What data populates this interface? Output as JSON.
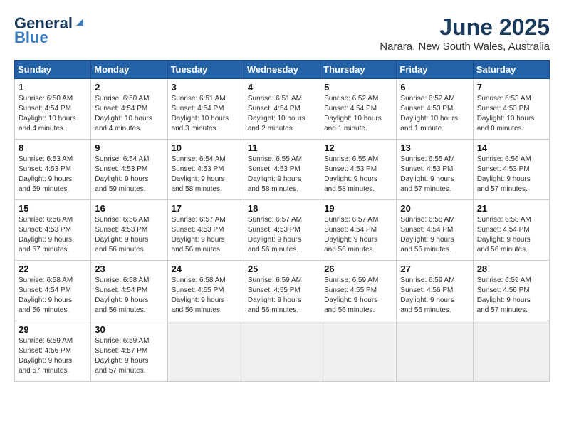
{
  "logo": {
    "line1": "General",
    "line2": "Blue"
  },
  "title": "June 2025",
  "location": "Narara, New South Wales, Australia",
  "headers": [
    "Sunday",
    "Monday",
    "Tuesday",
    "Wednesday",
    "Thursday",
    "Friday",
    "Saturday"
  ],
  "weeks": [
    [
      {
        "day": "1",
        "text": "Sunrise: 6:50 AM\nSunset: 4:54 PM\nDaylight: 10 hours\nand 4 minutes."
      },
      {
        "day": "2",
        "text": "Sunrise: 6:50 AM\nSunset: 4:54 PM\nDaylight: 10 hours\nand 4 minutes."
      },
      {
        "day": "3",
        "text": "Sunrise: 6:51 AM\nSunset: 4:54 PM\nDaylight: 10 hours\nand 3 minutes."
      },
      {
        "day": "4",
        "text": "Sunrise: 6:51 AM\nSunset: 4:54 PM\nDaylight: 10 hours\nand 2 minutes."
      },
      {
        "day": "5",
        "text": "Sunrise: 6:52 AM\nSunset: 4:54 PM\nDaylight: 10 hours\nand 1 minute."
      },
      {
        "day": "6",
        "text": "Sunrise: 6:52 AM\nSunset: 4:53 PM\nDaylight: 10 hours\nand 1 minute."
      },
      {
        "day": "7",
        "text": "Sunrise: 6:53 AM\nSunset: 4:53 PM\nDaylight: 10 hours\nand 0 minutes."
      }
    ],
    [
      {
        "day": "8",
        "text": "Sunrise: 6:53 AM\nSunset: 4:53 PM\nDaylight: 9 hours\nand 59 minutes."
      },
      {
        "day": "9",
        "text": "Sunrise: 6:54 AM\nSunset: 4:53 PM\nDaylight: 9 hours\nand 59 minutes."
      },
      {
        "day": "10",
        "text": "Sunrise: 6:54 AM\nSunset: 4:53 PM\nDaylight: 9 hours\nand 58 minutes."
      },
      {
        "day": "11",
        "text": "Sunrise: 6:55 AM\nSunset: 4:53 PM\nDaylight: 9 hours\nand 58 minutes."
      },
      {
        "day": "12",
        "text": "Sunrise: 6:55 AM\nSunset: 4:53 PM\nDaylight: 9 hours\nand 58 minutes."
      },
      {
        "day": "13",
        "text": "Sunrise: 6:55 AM\nSunset: 4:53 PM\nDaylight: 9 hours\nand 57 minutes."
      },
      {
        "day": "14",
        "text": "Sunrise: 6:56 AM\nSunset: 4:53 PM\nDaylight: 9 hours\nand 57 minutes."
      }
    ],
    [
      {
        "day": "15",
        "text": "Sunrise: 6:56 AM\nSunset: 4:53 PM\nDaylight: 9 hours\nand 57 minutes."
      },
      {
        "day": "16",
        "text": "Sunrise: 6:56 AM\nSunset: 4:53 PM\nDaylight: 9 hours\nand 56 minutes."
      },
      {
        "day": "17",
        "text": "Sunrise: 6:57 AM\nSunset: 4:53 PM\nDaylight: 9 hours\nand 56 minutes."
      },
      {
        "day": "18",
        "text": "Sunrise: 6:57 AM\nSunset: 4:53 PM\nDaylight: 9 hours\nand 56 minutes."
      },
      {
        "day": "19",
        "text": "Sunrise: 6:57 AM\nSunset: 4:54 PM\nDaylight: 9 hours\nand 56 minutes."
      },
      {
        "day": "20",
        "text": "Sunrise: 6:58 AM\nSunset: 4:54 PM\nDaylight: 9 hours\nand 56 minutes."
      },
      {
        "day": "21",
        "text": "Sunrise: 6:58 AM\nSunset: 4:54 PM\nDaylight: 9 hours\nand 56 minutes."
      }
    ],
    [
      {
        "day": "22",
        "text": "Sunrise: 6:58 AM\nSunset: 4:54 PM\nDaylight: 9 hours\nand 56 minutes."
      },
      {
        "day": "23",
        "text": "Sunrise: 6:58 AM\nSunset: 4:54 PM\nDaylight: 9 hours\nand 56 minutes."
      },
      {
        "day": "24",
        "text": "Sunrise: 6:58 AM\nSunset: 4:55 PM\nDaylight: 9 hours\nand 56 minutes."
      },
      {
        "day": "25",
        "text": "Sunrise: 6:59 AM\nSunset: 4:55 PM\nDaylight: 9 hours\nand 56 minutes."
      },
      {
        "day": "26",
        "text": "Sunrise: 6:59 AM\nSunset: 4:55 PM\nDaylight: 9 hours\nand 56 minutes."
      },
      {
        "day": "27",
        "text": "Sunrise: 6:59 AM\nSunset: 4:56 PM\nDaylight: 9 hours\nand 56 minutes."
      },
      {
        "day": "28",
        "text": "Sunrise: 6:59 AM\nSunset: 4:56 PM\nDaylight: 9 hours\nand 57 minutes."
      }
    ],
    [
      {
        "day": "29",
        "text": "Sunrise: 6:59 AM\nSunset: 4:56 PM\nDaylight: 9 hours\nand 57 minutes."
      },
      {
        "day": "30",
        "text": "Sunrise: 6:59 AM\nSunset: 4:57 PM\nDaylight: 9 hours\nand 57 minutes."
      },
      {
        "day": "",
        "text": ""
      },
      {
        "day": "",
        "text": ""
      },
      {
        "day": "",
        "text": ""
      },
      {
        "day": "",
        "text": ""
      },
      {
        "day": "",
        "text": ""
      }
    ]
  ]
}
